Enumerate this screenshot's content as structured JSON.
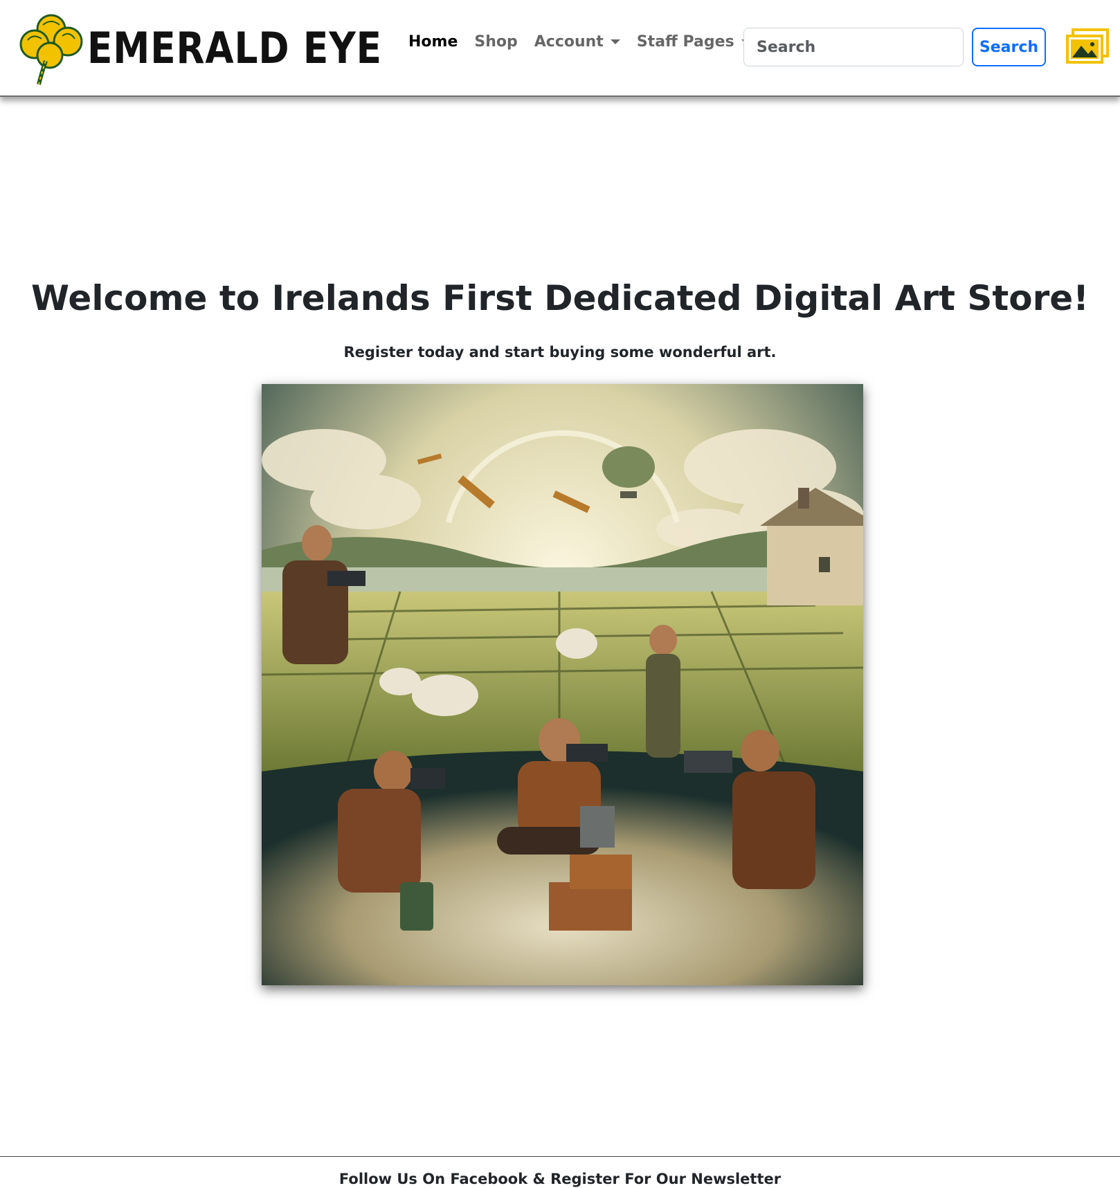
{
  "navbar": {
    "brand_name": "EMERALD EYE",
    "logo_icon": "shamrock-icon",
    "links": [
      {
        "label": "Home",
        "active": true,
        "dropdown": false
      },
      {
        "label": "Shop",
        "active": false,
        "dropdown": false
      },
      {
        "label": "Account",
        "active": false,
        "dropdown": true
      },
      {
        "label": "Staff Pages",
        "active": false,
        "dropdown": true
      }
    ],
    "search": {
      "placeholder": "Search",
      "value": ""
    },
    "search_button_label": "Search",
    "gallery_icon": "gallery-icon"
  },
  "hero": {
    "title": "Welcome to Irelands First Dedicated Digital Art Store!",
    "subtitle": "Register today and start buying some wonderful art.",
    "image_alt": "Painting of photographers in the Irish countryside"
  },
  "footer": {
    "text": "Follow Us On Facebook & Register For Our Newsletter"
  },
  "colors": {
    "accent": "#0d6efd",
    "logo_yellow": "#f2c200",
    "logo_green": "#1f5a1f",
    "text": "#212529"
  }
}
